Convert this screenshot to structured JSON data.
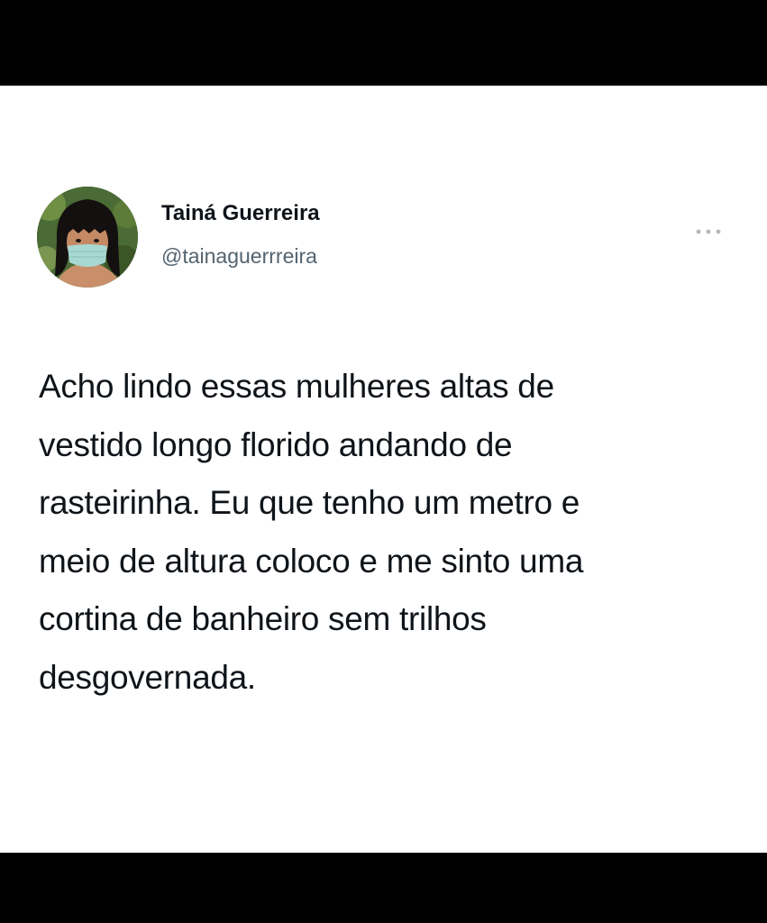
{
  "tweet": {
    "author": {
      "display_name": "Tainá Guerreira",
      "handle": "@tainaguerrreira",
      "avatar_icon": "profile-photo"
    },
    "more_icon": "more-horizontal-icon",
    "text_lines": [
      "Acho lindo essas mulheres altas de",
      "vestido longo florido andando de",
      "rasteirinha. Eu que tenho um metro e",
      "meio de altura coloco e me sinto uma",
      "cortina de banheiro sem trilhos",
      "desgovernada."
    ]
  },
  "colors": {
    "background_frame": "#000000",
    "card_background": "#ffffff",
    "primary_text": "#0f1419",
    "secondary_text": "#536471"
  }
}
